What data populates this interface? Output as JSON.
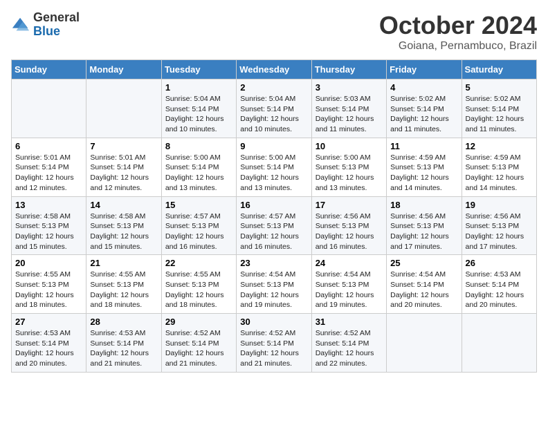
{
  "logo": {
    "general": "General",
    "blue": "Blue"
  },
  "title": "October 2024",
  "location": "Goiana, Pernambuco, Brazil",
  "days_of_week": [
    "Sunday",
    "Monday",
    "Tuesday",
    "Wednesday",
    "Thursday",
    "Friday",
    "Saturday"
  ],
  "weeks": [
    [
      {
        "day": "",
        "sunrise": "",
        "sunset": "",
        "daylight": ""
      },
      {
        "day": "",
        "sunrise": "",
        "sunset": "",
        "daylight": ""
      },
      {
        "day": "1",
        "sunrise": "Sunrise: 5:04 AM",
        "sunset": "Sunset: 5:14 PM",
        "daylight": "Daylight: 12 hours and 10 minutes."
      },
      {
        "day": "2",
        "sunrise": "Sunrise: 5:04 AM",
        "sunset": "Sunset: 5:14 PM",
        "daylight": "Daylight: 12 hours and 10 minutes."
      },
      {
        "day": "3",
        "sunrise": "Sunrise: 5:03 AM",
        "sunset": "Sunset: 5:14 PM",
        "daylight": "Daylight: 12 hours and 11 minutes."
      },
      {
        "day": "4",
        "sunrise": "Sunrise: 5:02 AM",
        "sunset": "Sunset: 5:14 PM",
        "daylight": "Daylight: 12 hours and 11 minutes."
      },
      {
        "day": "5",
        "sunrise": "Sunrise: 5:02 AM",
        "sunset": "Sunset: 5:14 PM",
        "daylight": "Daylight: 12 hours and 11 minutes."
      }
    ],
    [
      {
        "day": "6",
        "sunrise": "Sunrise: 5:01 AM",
        "sunset": "Sunset: 5:14 PM",
        "daylight": "Daylight: 12 hours and 12 minutes."
      },
      {
        "day": "7",
        "sunrise": "Sunrise: 5:01 AM",
        "sunset": "Sunset: 5:14 PM",
        "daylight": "Daylight: 12 hours and 12 minutes."
      },
      {
        "day": "8",
        "sunrise": "Sunrise: 5:00 AM",
        "sunset": "Sunset: 5:14 PM",
        "daylight": "Daylight: 12 hours and 13 minutes."
      },
      {
        "day": "9",
        "sunrise": "Sunrise: 5:00 AM",
        "sunset": "Sunset: 5:14 PM",
        "daylight": "Daylight: 12 hours and 13 minutes."
      },
      {
        "day": "10",
        "sunrise": "Sunrise: 5:00 AM",
        "sunset": "Sunset: 5:13 PM",
        "daylight": "Daylight: 12 hours and 13 minutes."
      },
      {
        "day": "11",
        "sunrise": "Sunrise: 4:59 AM",
        "sunset": "Sunset: 5:13 PM",
        "daylight": "Daylight: 12 hours and 14 minutes."
      },
      {
        "day": "12",
        "sunrise": "Sunrise: 4:59 AM",
        "sunset": "Sunset: 5:13 PM",
        "daylight": "Daylight: 12 hours and 14 minutes."
      }
    ],
    [
      {
        "day": "13",
        "sunrise": "Sunrise: 4:58 AM",
        "sunset": "Sunset: 5:13 PM",
        "daylight": "Daylight: 12 hours and 15 minutes."
      },
      {
        "day": "14",
        "sunrise": "Sunrise: 4:58 AM",
        "sunset": "Sunset: 5:13 PM",
        "daylight": "Daylight: 12 hours and 15 minutes."
      },
      {
        "day": "15",
        "sunrise": "Sunrise: 4:57 AM",
        "sunset": "Sunset: 5:13 PM",
        "daylight": "Daylight: 12 hours and 16 minutes."
      },
      {
        "day": "16",
        "sunrise": "Sunrise: 4:57 AM",
        "sunset": "Sunset: 5:13 PM",
        "daylight": "Daylight: 12 hours and 16 minutes."
      },
      {
        "day": "17",
        "sunrise": "Sunrise: 4:56 AM",
        "sunset": "Sunset: 5:13 PM",
        "daylight": "Daylight: 12 hours and 16 minutes."
      },
      {
        "day": "18",
        "sunrise": "Sunrise: 4:56 AM",
        "sunset": "Sunset: 5:13 PM",
        "daylight": "Daylight: 12 hours and 17 minutes."
      },
      {
        "day": "19",
        "sunrise": "Sunrise: 4:56 AM",
        "sunset": "Sunset: 5:13 PM",
        "daylight": "Daylight: 12 hours and 17 minutes."
      }
    ],
    [
      {
        "day": "20",
        "sunrise": "Sunrise: 4:55 AM",
        "sunset": "Sunset: 5:13 PM",
        "daylight": "Daylight: 12 hours and 18 minutes."
      },
      {
        "day": "21",
        "sunrise": "Sunrise: 4:55 AM",
        "sunset": "Sunset: 5:13 PM",
        "daylight": "Daylight: 12 hours and 18 minutes."
      },
      {
        "day": "22",
        "sunrise": "Sunrise: 4:55 AM",
        "sunset": "Sunset: 5:13 PM",
        "daylight": "Daylight: 12 hours and 18 minutes."
      },
      {
        "day": "23",
        "sunrise": "Sunrise: 4:54 AM",
        "sunset": "Sunset: 5:13 PM",
        "daylight": "Daylight: 12 hours and 19 minutes."
      },
      {
        "day": "24",
        "sunrise": "Sunrise: 4:54 AM",
        "sunset": "Sunset: 5:13 PM",
        "daylight": "Daylight: 12 hours and 19 minutes."
      },
      {
        "day": "25",
        "sunrise": "Sunrise: 4:54 AM",
        "sunset": "Sunset: 5:14 PM",
        "daylight": "Daylight: 12 hours and 20 minutes."
      },
      {
        "day": "26",
        "sunrise": "Sunrise: 4:53 AM",
        "sunset": "Sunset: 5:14 PM",
        "daylight": "Daylight: 12 hours and 20 minutes."
      }
    ],
    [
      {
        "day": "27",
        "sunrise": "Sunrise: 4:53 AM",
        "sunset": "Sunset: 5:14 PM",
        "daylight": "Daylight: 12 hours and 20 minutes."
      },
      {
        "day": "28",
        "sunrise": "Sunrise: 4:53 AM",
        "sunset": "Sunset: 5:14 PM",
        "daylight": "Daylight: 12 hours and 21 minutes."
      },
      {
        "day": "29",
        "sunrise": "Sunrise: 4:52 AM",
        "sunset": "Sunset: 5:14 PM",
        "daylight": "Daylight: 12 hours and 21 minutes."
      },
      {
        "day": "30",
        "sunrise": "Sunrise: 4:52 AM",
        "sunset": "Sunset: 5:14 PM",
        "daylight": "Daylight: 12 hours and 21 minutes."
      },
      {
        "day": "31",
        "sunrise": "Sunrise: 4:52 AM",
        "sunset": "Sunset: 5:14 PM",
        "daylight": "Daylight: 12 hours and 22 minutes."
      },
      {
        "day": "",
        "sunrise": "",
        "sunset": "",
        "daylight": ""
      },
      {
        "day": "",
        "sunrise": "",
        "sunset": "",
        "daylight": ""
      }
    ]
  ]
}
